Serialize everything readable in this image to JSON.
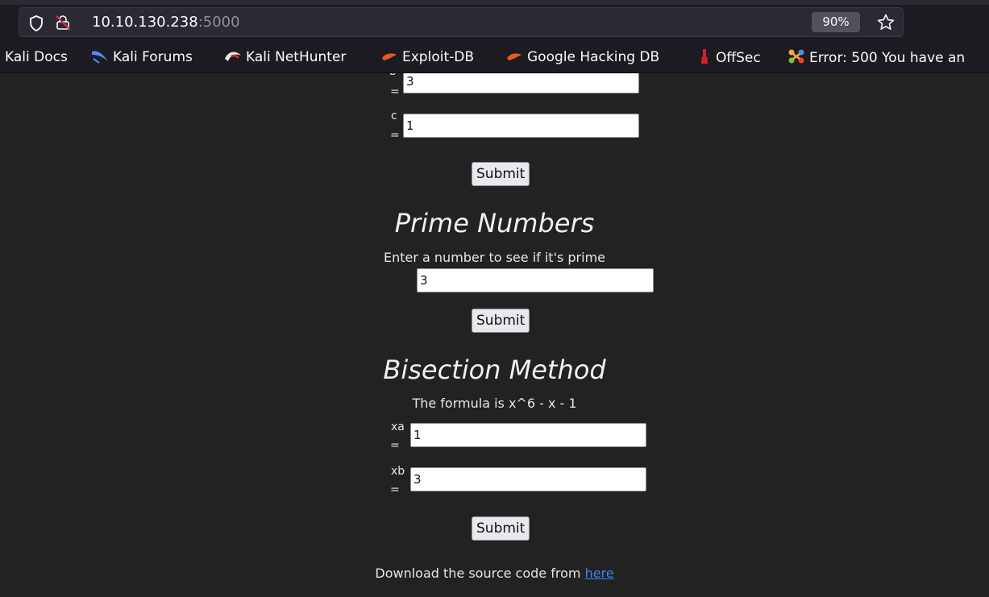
{
  "browser": {
    "url_host": "10.10.130.238",
    "url_port": ":5000",
    "zoom": "90%",
    "bookmarks": [
      {
        "label": "Kali Docs",
        "icon": "kali-docs-icon"
      },
      {
        "label": "Kali Forums",
        "icon": "kali-forums-icon"
      },
      {
        "label": "Kali NetHunter",
        "icon": "kali-nethunter-icon"
      },
      {
        "label": "Exploit-DB",
        "icon": "exploit-db-icon"
      },
      {
        "label": "Google Hacking DB",
        "icon": "exploit-db-icon"
      },
      {
        "label": "OffSec",
        "icon": "offsec-icon"
      },
      {
        "label": "Error: 500 You have an",
        "icon": "joomla-icon"
      }
    ]
  },
  "quadratic": {
    "b_label": "b",
    "b_eq": "=",
    "b_value": "3",
    "c_label": "c",
    "c_eq": "=",
    "c_value": "1",
    "submit_label": "Submit"
  },
  "prime": {
    "heading": "Prime Numbers",
    "instruction": "Enter a number to see if it's prime",
    "value": "3",
    "submit_label": "Submit"
  },
  "bisection": {
    "heading": "Bisection Method",
    "formula": "The formula is x^6 - x - 1",
    "xa_label": "xa",
    "xa_eq": "=",
    "xa_value": "1",
    "xb_label": "xb",
    "xb_eq": "=",
    "xb_value": "3",
    "submit_label": "Submit"
  },
  "footer": {
    "text": "Download the source code from",
    "link_label": "here"
  }
}
